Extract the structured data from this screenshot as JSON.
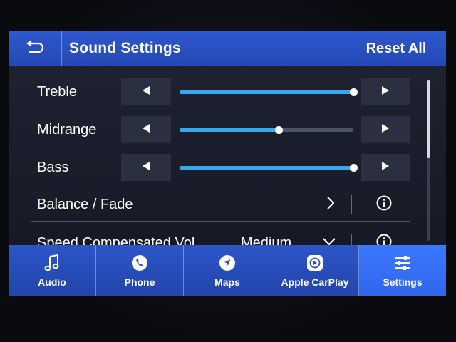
{
  "header": {
    "title": "Sound Settings",
    "reset_label": "Reset All"
  },
  "sliders": [
    {
      "label": "Treble",
      "level": 1.0
    },
    {
      "label": "Midrange",
      "level": 0.57
    },
    {
      "label": "Bass",
      "level": 1.0
    }
  ],
  "balance": {
    "label": "Balance / Fade"
  },
  "speed": {
    "label": "Speed Compensated Vol",
    "value": "Medium"
  },
  "nav": {
    "items": [
      {
        "label": "Audio",
        "icon": "music-note-icon"
      },
      {
        "label": "Phone",
        "icon": "phone-icon"
      },
      {
        "label": "Maps",
        "icon": "navigation-icon"
      },
      {
        "label": "Apple CarPlay",
        "icon": "carplay-icon"
      },
      {
        "label": "Settings",
        "icon": "settings-sliders-icon"
      }
    ],
    "active": "Settings"
  },
  "colors": {
    "accent": "#39a8ec",
    "header": "#2f58ce",
    "active_tab": "#3a78ff"
  }
}
